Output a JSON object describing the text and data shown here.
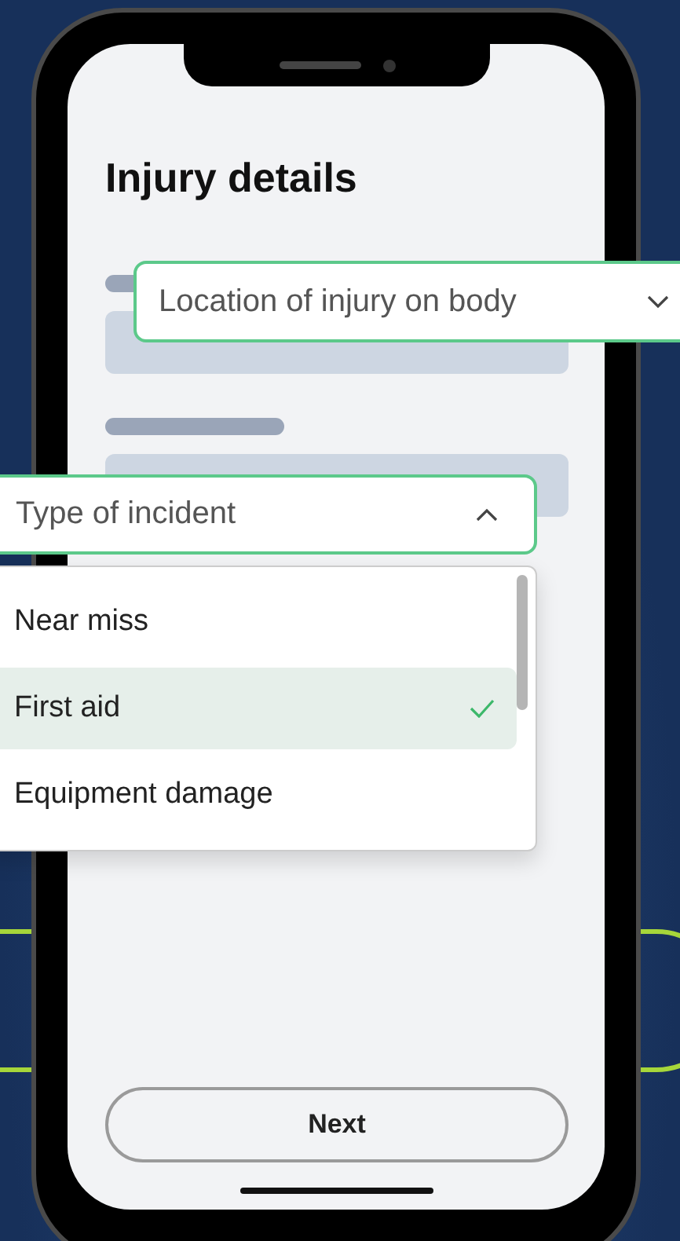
{
  "screen_title": "Injury details",
  "location_dropdown": {
    "label": "Location of injury on body",
    "expanded": false
  },
  "incident_dropdown": {
    "label": "Type of incident",
    "expanded": true,
    "options": [
      {
        "label": "Near miss",
        "selected": false
      },
      {
        "label": "First aid",
        "selected": true
      },
      {
        "label": "Equipment damage",
        "selected": false
      }
    ]
  },
  "next_button": {
    "label": "Next"
  }
}
